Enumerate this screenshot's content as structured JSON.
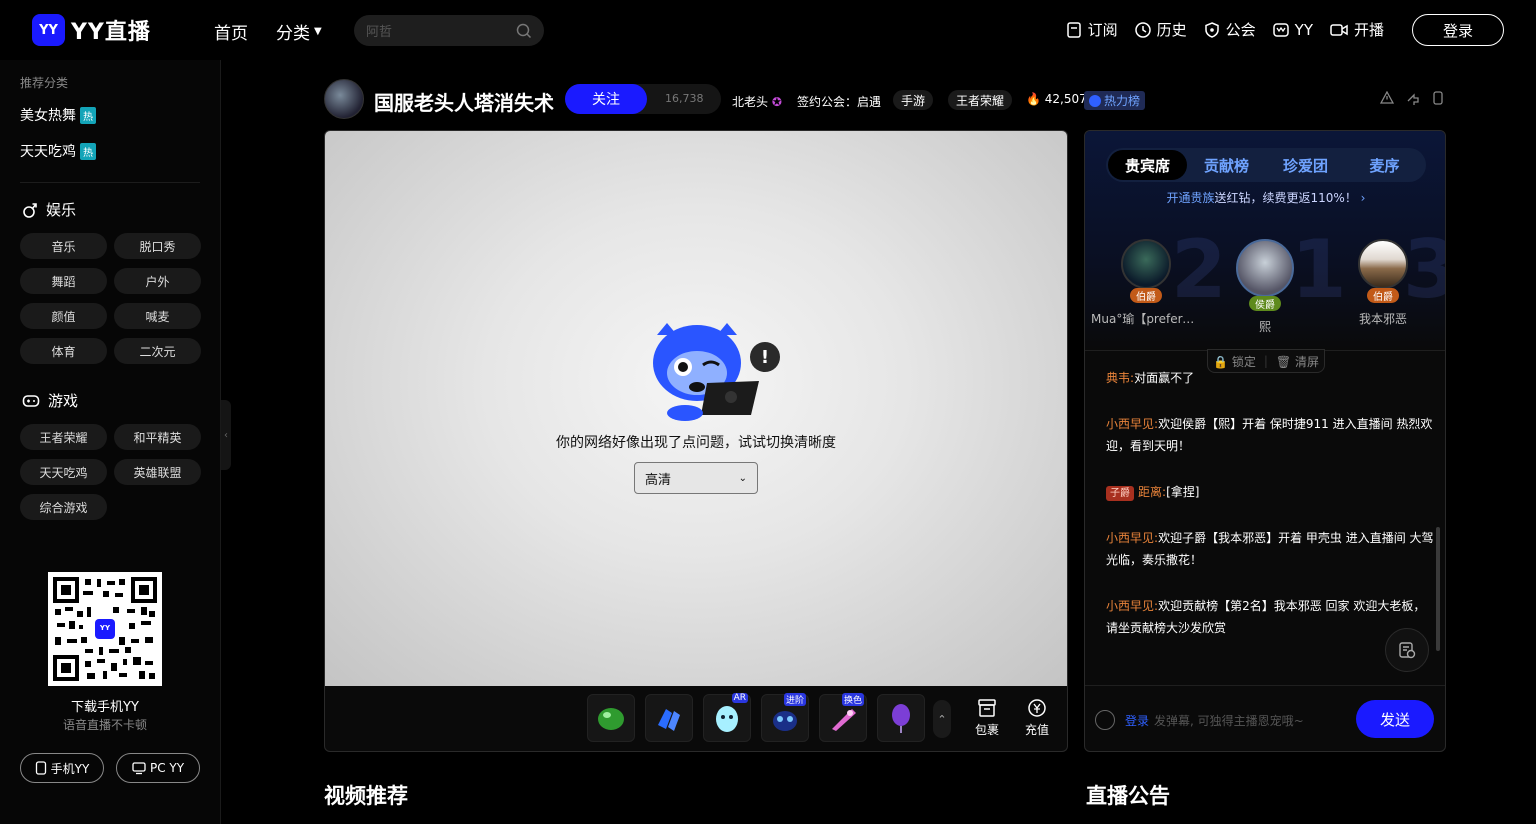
{
  "header": {
    "logo_mark": "YY",
    "logo_text": "YY直播",
    "nav_home": "首页",
    "nav_category": "分类",
    "search_placeholder": "阿哲",
    "links": [
      "订阅",
      "历史",
      "公会",
      "YY",
      "开播"
    ],
    "login": "登录"
  },
  "sidebar": {
    "section_title": "推荐分类",
    "hot_items": [
      {
        "label": "美女热舞",
        "badge": "热"
      },
      {
        "label": "天天吃鸡",
        "badge": "热"
      }
    ],
    "entertainment": {
      "title": "娱乐",
      "chips": [
        "音乐",
        "脱口秀",
        "舞蹈",
        "户外",
        "颜值",
        "喊麦",
        "体育",
        "二次元"
      ]
    },
    "games": {
      "title": "游戏",
      "chips": [
        "王者荣耀",
        "和平精英",
        "天天吃鸡",
        "英雄联盟",
        "综合游戏"
      ]
    },
    "qr_mark": "YY",
    "download_title": "下载手机YY",
    "download_sub": "语音直播不卡顿",
    "app_buttons": [
      "手机YY",
      "PC YY"
    ]
  },
  "room": {
    "title": "国服老头人塔消失术",
    "follow": "关注",
    "follow_count": "16,738",
    "anchor": "北老头",
    "guild": "签约公会：启遇",
    "tags": [
      "手游",
      "王者荣耀"
    ],
    "heat": "42,507",
    "heat_badge": "热力榜"
  },
  "player": {
    "error": "你的网络好像出现了点问题，试试切换清晰度",
    "quality": "高清"
  },
  "gift_bar": {
    "gift_tags": [
      "AR",
      "进阶",
      "换色"
    ],
    "bag": "包裹",
    "recharge": "充值"
  },
  "panel": {
    "tabs": [
      "贵宾席",
      "贡献榜",
      "珍爱团",
      "麦序"
    ],
    "noble_highlight": "开通贵族",
    "noble_text": "送红钻，续费更返110%！",
    "seats": [
      {
        "rank": "伯爵",
        "name": "Mua°瑜【preference】"
      },
      {
        "rank": "侯爵",
        "name": "熙"
      },
      {
        "rank": "伯爵",
        "name": "我本邪恶"
      }
    ],
    "big_numbers": [
      "2",
      "1",
      "3"
    ],
    "lock": "锁定",
    "clear": "清屏",
    "messages": [
      {
        "user": "典韦",
        "text": "对面赢不了"
      },
      {
        "user": "小西早见",
        "text": "欢迎侯爵【熙】开着 保时捷911 进入直播间 热烈欢迎，看到天明！"
      },
      {
        "level": "子爵",
        "user": "距离",
        "text": "[拿捏]"
      },
      {
        "user": "小西早见",
        "text": "欢迎子爵【我本邪恶】开着 甲壳虫 进入直播间 大驾光临，奏乐撒花！"
      },
      {
        "user": "小西早见",
        "text": "欢迎贡献榜【第2名】我本邪恶   回家   欢迎大老板，请坐贡献榜大沙发欣赏"
      }
    ],
    "chat_login": "登录",
    "chat_placeholder": "发弹幕, 可独得主播恩宠哦~",
    "send": "发送"
  },
  "sections": {
    "video": "视频推荐",
    "notice": "直播公告"
  },
  "colors": {
    "accent": "#1a1aff",
    "hot": "#13a4b8",
    "username": "#e8833a"
  }
}
